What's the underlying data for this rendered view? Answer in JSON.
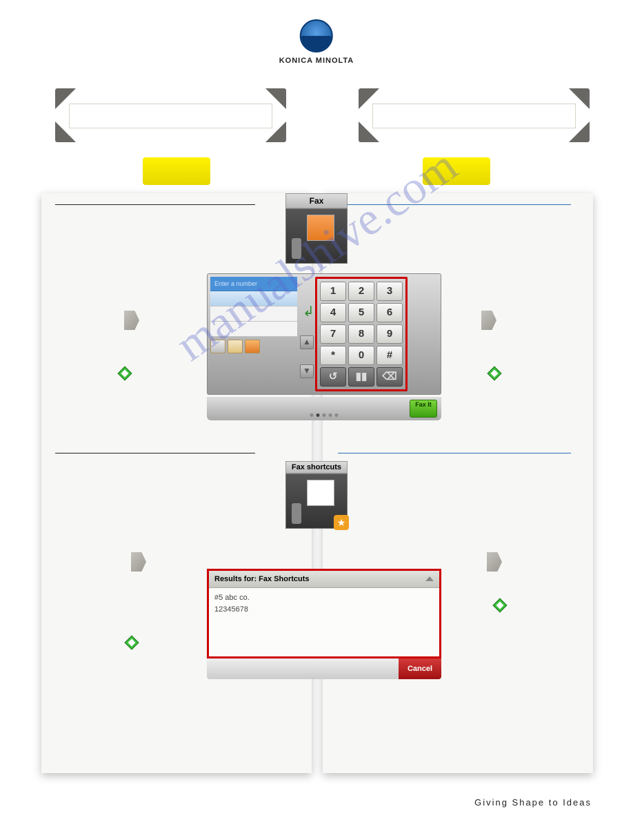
{
  "brand": "KONICA MINOLTA",
  "footer": "Giving Shape to Ideas",
  "watermark": "manualshive.com",
  "fax_app": {
    "title": "Fax",
    "input_placeholder": "Enter a number",
    "keys_row1": [
      "1",
      "2",
      "3"
    ],
    "keys_row2": [
      "4",
      "5",
      "6"
    ],
    "keys_row3": [
      "7",
      "8",
      "9"
    ],
    "keys_row4": [
      "*",
      "0",
      "#"
    ],
    "util_keys": [
      "↺",
      "▮▮",
      "⌫"
    ],
    "action": "Fax It"
  },
  "fax_shortcuts": {
    "title": "Fax shortcuts",
    "results_header": "Results for: Fax Shortcuts",
    "rows": [
      "#5 abc co.",
      "12345678"
    ],
    "cancel": "Cancel"
  }
}
